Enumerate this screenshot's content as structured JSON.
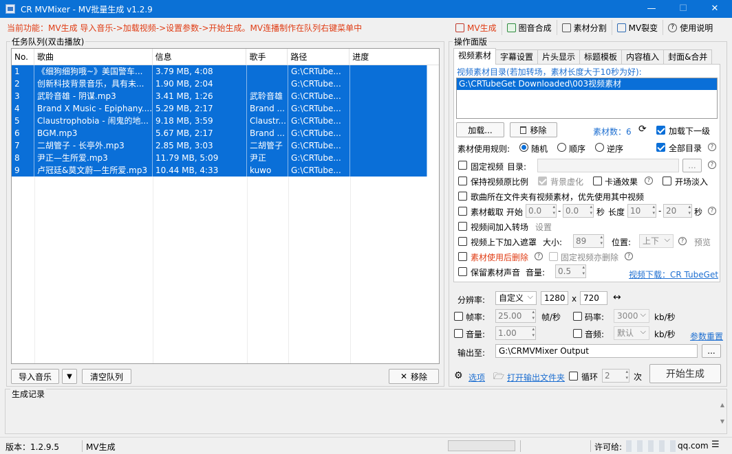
{
  "window": {
    "title": "CR MVMixer - MV批量生成 v1.2.9",
    "min": "—",
    "max": "☐",
    "close": "✕"
  },
  "func_line": "当前功能：MV生成  导入音乐->加载视频->设置参数->开始生成。MV连播制作在队列右键菜单中",
  "topnav": [
    {
      "label": "MV生成",
      "icon": "film-icon"
    },
    {
      "label": "图音合成",
      "icon": "image-audio-icon"
    },
    {
      "label": "素材分割",
      "icon": "split-icon"
    },
    {
      "label": "MV裂变",
      "icon": "fission-icon"
    },
    {
      "label": "使用说明",
      "icon": "help-icon"
    }
  ],
  "queue": {
    "title": "任务队列(双击播放)",
    "columns": [
      "No.",
      "歌曲",
      "信息",
      "歌手",
      "路径",
      "进度"
    ],
    "rows": [
      {
        "no": "1",
        "song": "《细狗细狗哦~》美国警车...",
        "info": "3.79 MB, 4:08",
        "artist": "",
        "path": "G:\\CRTube...",
        "progress": ""
      },
      {
        "no": "2",
        "song": "创新科技背景音乐，具有未...",
        "info": "1.90 MB, 2:04",
        "artist": "",
        "path": "G:\\CRTube...",
        "progress": ""
      },
      {
        "no": "3",
        "song": "武聆音雄 - 阴谋.mp3",
        "info": "3.41 MB, 1:26",
        "artist": "武聆音雄",
        "path": "G:\\CRTube...",
        "progress": ""
      },
      {
        "no": "4",
        "song": "Brand X Music - Epiphany....",
        "info": "5.29 MB, 2:17",
        "artist": "Brand ...",
        "path": "G:\\CRTube...",
        "progress": ""
      },
      {
        "no": "5",
        "song": "Claustrophobia - 闹鬼的地...",
        "info": "9.18 MB, 3:59",
        "artist": "Claustr...",
        "path": "G:\\CRTube...",
        "progress": ""
      },
      {
        "no": "6",
        "song": "BGM.mp3",
        "info": "5.67 MB, 2:17",
        "artist": "Brand ...",
        "path": "G:\\CRTube...",
        "progress": ""
      },
      {
        "no": "7",
        "song": "二胡管子 - 长亭外.mp3",
        "info": "2.85 MB, 3:03",
        "artist": "二胡管子",
        "path": "G:\\CRTube...",
        "progress": ""
      },
      {
        "no": "8",
        "song": "尹正—生所爱.mp3",
        "info": "11.79 MB, 5:09",
        "artist": "尹正",
        "path": "G:\\CRTube...",
        "progress": ""
      },
      {
        "no": "9",
        "song": "卢冠廷&莫文蔚—生所爱.mp3",
        "info": "10.44 MB, 4:33",
        "artist": "kuwo",
        "path": "G:\\CRTube...",
        "progress": ""
      }
    ],
    "import_label": "导入音乐",
    "clear_label": "清空队列",
    "remove_label": "移除"
  },
  "panel": {
    "title": "操作面版",
    "tabs": [
      "视频素材",
      "字幕设置",
      "片头显示",
      "标题模板",
      "内容植入",
      "封面&合并"
    ],
    "dir_label": "视频素材目录(若加转场，素材长度大于10秒为好):",
    "dir_items": [
      "G:\\CRTubeGet Downloaded\\003视频素材"
    ],
    "load_label": "加载...",
    "remove_label": "移除",
    "count_label": "素材数：6",
    "load_next_label": "加载下一级",
    "rule_label": "素材使用规则:",
    "rule_options": [
      "随机",
      "顺序",
      "逆序"
    ],
    "all_dirs_label": "全部目录",
    "fixed_video_label": "固定视频",
    "fixed_dir_label": "目录:",
    "browse_label": "...",
    "keep_ratio_label": "保持视频原比例",
    "bg_blur_label": "背景虚化",
    "cartoon_label": "卡通效果",
    "fade_in_label": "开场淡入",
    "prefer_song_dir_label": "歌曲所在文件夹有视频素材，优先使用其中视频",
    "clip_label": "素材截取",
    "start_label": "开始",
    "start_a": "0.0",
    "dash": "-",
    "start_b": "0.0",
    "sec_label": "秒",
    "length_label": "长度",
    "length_a": "10",
    "length_b": "20",
    "sec_label2": "秒",
    "transition_label": "视频间加入转场",
    "settings_link": "设置",
    "mask_label": "视频上下加入遮罩",
    "size_label": "大小:",
    "size_value": "89",
    "position_label": "位置:",
    "position_value": "上下",
    "preview_link": "预览",
    "delete_after_label": "素材使用后删除",
    "fixed_delete_label": "固定视频亦删除",
    "keep_audio_label": "保留素材声音",
    "volume_label": "音量:",
    "volume_value": "0.5",
    "download_link": "视频下载：CR TubeGet"
  },
  "output": {
    "resolution_label": "分辨率:",
    "resolution_mode": "自定义",
    "width": "1280",
    "x": "x",
    "height": "720",
    "swap_icon": "↔",
    "fps_label": "帧率:",
    "fps_value": "25.00",
    "fps_unit": "帧/秒",
    "bitrate_label": "码率:",
    "bitrate_value": "3000",
    "bitrate_unit": "kb/秒",
    "volume_label": "音量:",
    "volume_value": "1.00",
    "audio_label": "音频:",
    "audio_value": "默认",
    "audio_unit": "kb/秒",
    "reset_link": "参数重置",
    "output_label": "输出至:",
    "output_path": "G:\\CRMVMixer Output",
    "browse_label": "...",
    "options_link": "选项",
    "open_folder_link": "打开输出文件夹",
    "loop_label": "循环",
    "loop_value": "2",
    "times_label": "次",
    "start_label": "开始生成"
  },
  "log": {
    "title": "生成记录"
  },
  "status": {
    "version": "版本：1.2.9.5",
    "mode": "MV生成",
    "license_label": "许可给:",
    "license_value": "qq.com"
  }
}
